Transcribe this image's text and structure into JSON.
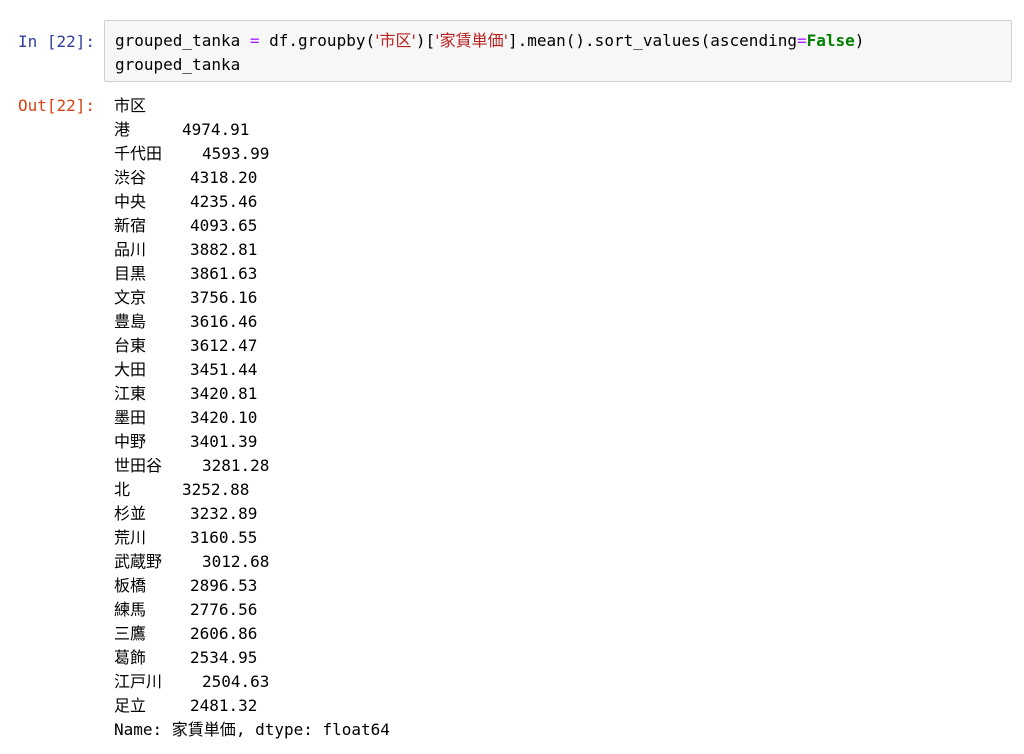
{
  "input_cell": {
    "prompt": "In [22]:",
    "code": {
      "line1": {
        "t1": "grouped_tanka ",
        "t2": "=",
        "t3": " df.groupby(",
        "t4": "'市区'",
        "t5": ")[",
        "t6": "'家賃単価'",
        "t7": "].mean().sort_values(ascending",
        "t8": "=",
        "t9": "False",
        "t10": ")"
      },
      "line2": "grouped_tanka"
    }
  },
  "output_cell": {
    "prompt": "Out[22]:",
    "index_name": "市区",
    "rows": [
      {
        "ward": "港",
        "value": "4974.91"
      },
      {
        "ward": "千代田",
        "value": "4593.99"
      },
      {
        "ward": "渋谷",
        "value": "4318.20"
      },
      {
        "ward": "中央",
        "value": "4235.46"
      },
      {
        "ward": "新宿",
        "value": "4093.65"
      },
      {
        "ward": "品川",
        "value": "3882.81"
      },
      {
        "ward": "目黒",
        "value": "3861.63"
      },
      {
        "ward": "文京",
        "value": "3756.16"
      },
      {
        "ward": "豊島",
        "value": "3616.46"
      },
      {
        "ward": "台東",
        "value": "3612.47"
      },
      {
        "ward": "大田",
        "value": "3451.44"
      },
      {
        "ward": "江東",
        "value": "3420.81"
      },
      {
        "ward": "墨田",
        "value": "3420.10"
      },
      {
        "ward": "中野",
        "value": "3401.39"
      },
      {
        "ward": "世田谷",
        "value": "3281.28"
      },
      {
        "ward": "北",
        "value": "3252.88"
      },
      {
        "ward": "杉並",
        "value": "3232.89"
      },
      {
        "ward": "荒川",
        "value": "3160.55"
      },
      {
        "ward": "武蔵野",
        "value": "3012.68"
      },
      {
        "ward": "板橋",
        "value": "2896.53"
      },
      {
        "ward": "練馬",
        "value": "2776.56"
      },
      {
        "ward": "三鷹",
        "value": "2606.86"
      },
      {
        "ward": "葛飾",
        "value": "2534.95"
      },
      {
        "ward": "江戸川",
        "value": "2504.63"
      },
      {
        "ward": "足立",
        "value": "2481.32"
      }
    ],
    "footer": {
      "prefix": "Name: ",
      "name": "家賃単価",
      "suffix": ", dtype: float64"
    }
  },
  "colors": {
    "in_prompt": "#303f9f",
    "out_prompt": "#d84315",
    "operator": "#aa22ff",
    "string": "#ba2121",
    "keyword": "#008000",
    "cell_bg": "#f7f7f7",
    "cell_border": "#cfcfcf"
  }
}
